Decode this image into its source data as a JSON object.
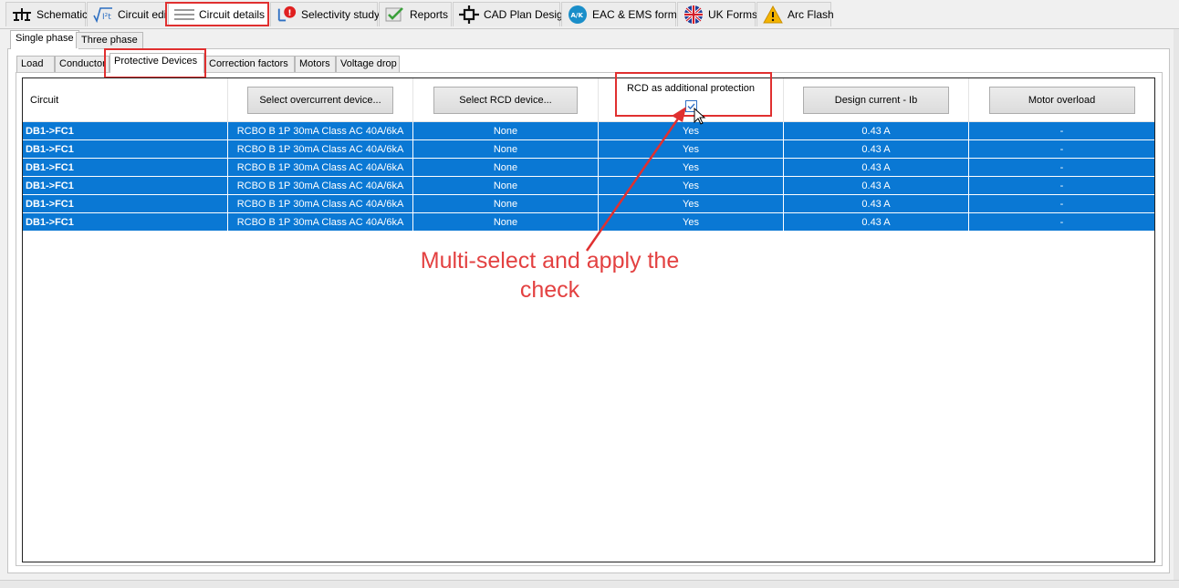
{
  "toolbar": {
    "tabs": [
      {
        "label": "Schematic",
        "icon": "schematic-icon"
      },
      {
        "label": "Circuit edit",
        "icon": "formula-icon"
      },
      {
        "label": "Circuit details",
        "icon": "list-icon"
      },
      {
        "label": "Selectivity study",
        "icon": "selectivity-icon"
      },
      {
        "label": "Reports",
        "icon": "check-report-icon"
      },
      {
        "label": "CAD Plan Design",
        "icon": "crosshair-icon"
      },
      {
        "label": "EAC & EMS forms",
        "icon": "globe-icon"
      },
      {
        "label": "UK Forms",
        "icon": "uk-flag-icon"
      },
      {
        "label": "Arc Flash",
        "icon": "warning-icon"
      }
    ],
    "active": "Circuit details"
  },
  "phase_tabs": [
    "Single phase",
    "Three phase"
  ],
  "sub_tabs": [
    "Load",
    "Conductor",
    "Protective Devices",
    "Correction factors",
    "Motors",
    "Voltage drop"
  ],
  "grid": {
    "headers": {
      "circuit": "Circuit",
      "overcurrent_btn": "Select overcurrent device...",
      "rcd_btn": "Select RCD device...",
      "rcd_additional": "RCD as additional protection",
      "design_current_btn": "Design current - Ib",
      "motor_overload_btn": "Motor overload"
    },
    "rows": [
      {
        "circuit": "DB1->FC1",
        "overcurrent": "RCBO B 1P 30mA Class AC 40A/6kA",
        "rcd": "None",
        "additional": "Yes",
        "current": "0.43 A",
        "motor": "-"
      },
      {
        "circuit": "DB1->FC1",
        "overcurrent": "RCBO B 1P 30mA Class AC 40A/6kA",
        "rcd": "None",
        "additional": "Yes",
        "current": "0.43 A",
        "motor": "-"
      },
      {
        "circuit": "DB1->FC1",
        "overcurrent": "RCBO B 1P 30mA Class AC 40A/6kA",
        "rcd": "None",
        "additional": "Yes",
        "current": "0.43 A",
        "motor": "-"
      },
      {
        "circuit": "DB1->FC1",
        "overcurrent": "RCBO B 1P 30mA Class AC 40A/6kA",
        "rcd": "None",
        "additional": "Yes",
        "current": "0.43 A",
        "motor": "-"
      },
      {
        "circuit": "DB1->FC1",
        "overcurrent": "RCBO B 1P 30mA Class AC 40A/6kA",
        "rcd": "None",
        "additional": "Yes",
        "current": "0.43 A",
        "motor": "-"
      },
      {
        "circuit": "DB1->FC1",
        "overcurrent": "RCBO B 1P 30mA Class AC 40A/6kA",
        "rcd": "None",
        "additional": "Yes",
        "current": "0.43 A",
        "motor": "-"
      }
    ]
  },
  "annotation": {
    "line1": "Multi-select and apply the",
    "line2": "check"
  },
  "colors": {
    "selection": "#0a78d4",
    "annotation": "#e03030"
  }
}
